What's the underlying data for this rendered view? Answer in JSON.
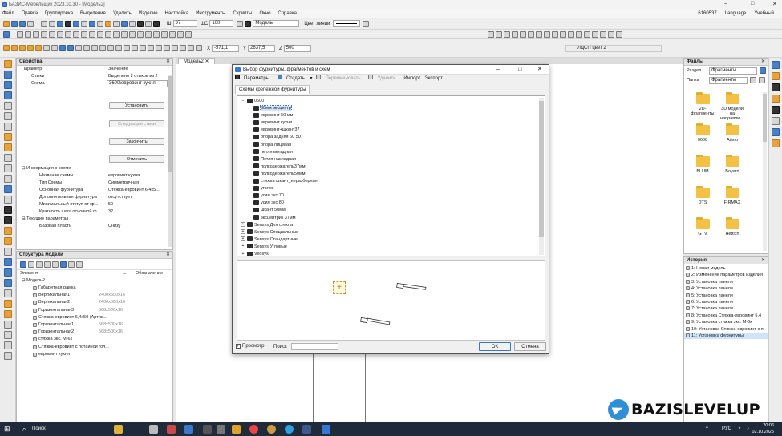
{
  "window": {
    "title": "БАЗИС-Мебельщик 2023.10.30 - [Модель2]",
    "min": "–",
    "max": "□",
    "close": "✕"
  },
  "menu": {
    "items": [
      "Файл",
      "Правка",
      "Группировка",
      "Выделение",
      "Удалить",
      "Изделие",
      "Настройка",
      "Инструменты",
      "Скрипты",
      "Окно",
      "Справка"
    ],
    "account": "6160537",
    "language": "Language",
    "user": "Учебный"
  },
  "toolbar": {
    "scale_label": "Ш",
    "scale_value": "37",
    "shs_label": "ШС",
    "shs_value": "100",
    "layer": "Модель",
    "line_color_label": "Цвет линии",
    "x_label": "X",
    "x_value": "-571,1",
    "y_label": "Y",
    "y_value": "2637,5",
    "z_label": "Z",
    "z_value": "500",
    "material": "ЛДСП цвет 2"
  },
  "properties": {
    "title": "Свойства",
    "col_param": "Параметр",
    "col_value": "Значение",
    "rows_top": [
      {
        "k": "Стыки",
        "v": "Выделено 2 стыков из 2"
      },
      {
        "k": "Схема",
        "v": "3600\\евровинт кухня"
      }
    ],
    "btn_install": "Установить",
    "btn_next": "Следующая стыки",
    "btn_finish": "Закончить",
    "btn_cancel": "Отменить",
    "section_info": "Информация о схеме",
    "rows_info": [
      {
        "k": "Название схемы",
        "v": "евровинт кухня"
      },
      {
        "k": "Тип Схемы",
        "v": "Симметричная"
      },
      {
        "k": "Основная фурнитура",
        "v": "Стяжка-евровинт 6,4х5..."
      },
      {
        "k": "Дополнительная фурнитура",
        "v": "отсутствует"
      },
      {
        "k": "Минимальный отступ от кр...",
        "v": "50"
      },
      {
        "k": "Кратность шага основной ф...",
        "v": "32"
      }
    ],
    "section_current": "Текущие параметры",
    "rows_current": [
      {
        "k": "Базовая пласть",
        "v": "Снизу"
      }
    ]
  },
  "structure": {
    "title": "Структура модели",
    "col_element": "Элемент",
    "col_dots": "...",
    "col_mark": "Обозначение",
    "root": "Модель2",
    "items": [
      {
        "name": "Габаритная рамка",
        "size": ""
      },
      {
        "name": "Вертикальная1",
        "size": "2400x500x16"
      },
      {
        "name": "Вертикальная2",
        "size": "2400x500x16"
      },
      {
        "name": "Горизонтальная3",
        "size": "568x500x16"
      },
      {
        "name": "Стяжка-евровинт 6,4х50 (Артик...",
        "size": ""
      },
      {
        "name": "Горизонтальная1",
        "size": "568x500x16"
      },
      {
        "name": "Горизонтальная2",
        "size": "568x500x16"
      },
      {
        "name": "стяжка экс. М-6к",
        "size": ""
      },
      {
        "name": "Стяжка-евровинт с потайной гол...",
        "size": ""
      },
      {
        "name": "евровинт кухня",
        "size": ""
      }
    ]
  },
  "tab": {
    "label": "Модель2"
  },
  "dialog": {
    "title": "Выбор фурнитуры, фрагментов и схем",
    "tb": {
      "params": "Параметры",
      "create": "Создать",
      "rename": "Переименовать",
      "delete": "Удалить",
      "import": "Импорт",
      "export": "Экспорт"
    },
    "subtab": "Схемы крепежной фурнитуры",
    "tree_root": "0600",
    "items": [
      "50мм эксцентр",
      "евровинт 50 мм",
      "евровинт кухня",
      "евровинт+шкант37",
      "опора задняя 60 50",
      "опора лицевая",
      "петля вкладная",
      "Петля накладная",
      "полкодержатель37мм",
      "полкодержатель50мм",
      "стяжка шкант_неразборная",
      "уголок",
      "усил экс 70",
      "усил экс 80",
      "шкант 50мм",
      "эксцентрик 37мм"
    ],
    "groups": [
      "Sensys Для стекла",
      "Sensys Специальные",
      "Sensys Стандартные",
      "Sensys Угловые",
      "Veosys"
    ],
    "preview_label": "Просмотр",
    "search_label": "Поиск",
    "search_value": "",
    "ok": "ОК",
    "cancel": "Отмена"
  },
  "files": {
    "title": "Файлы",
    "section_label": "Раздел",
    "section_value": "Фрагменты",
    "folder_label": "Папка",
    "folder_value": "Фрагменты",
    "items": [
      "2D-фрагменты",
      "3D модели на направлю...",
      "0600",
      "Aristo",
      "BLUM",
      "Boyard",
      "DTS",
      "FIRMAX",
      "GTV",
      "Hettich"
    ]
  },
  "history": {
    "title": "История",
    "items": [
      "1: Новая модель",
      "2: Изменение параметров изделия",
      "3: Установка панели",
      "4: Установка панели",
      "5: Установка панели",
      "6: Установка панели",
      "7: Установка панели",
      "8: Установка Стяжка-евровинт 6,4",
      "9: Установка стяжка экс. М-6к",
      "10: Установка Стяжка-евровинт с п",
      "11: Установка фурнитуры"
    ]
  },
  "taskbar": {
    "search": "Поиск",
    "lang": "РУС",
    "time": "20:06",
    "date": "02.10.2025"
  },
  "watermark": {
    "text": "BAZISLEVELUP"
  },
  "colors": {
    "accent": "#3478d4",
    "taskbar": "#1f2a3a",
    "folder": "#f3c244"
  }
}
